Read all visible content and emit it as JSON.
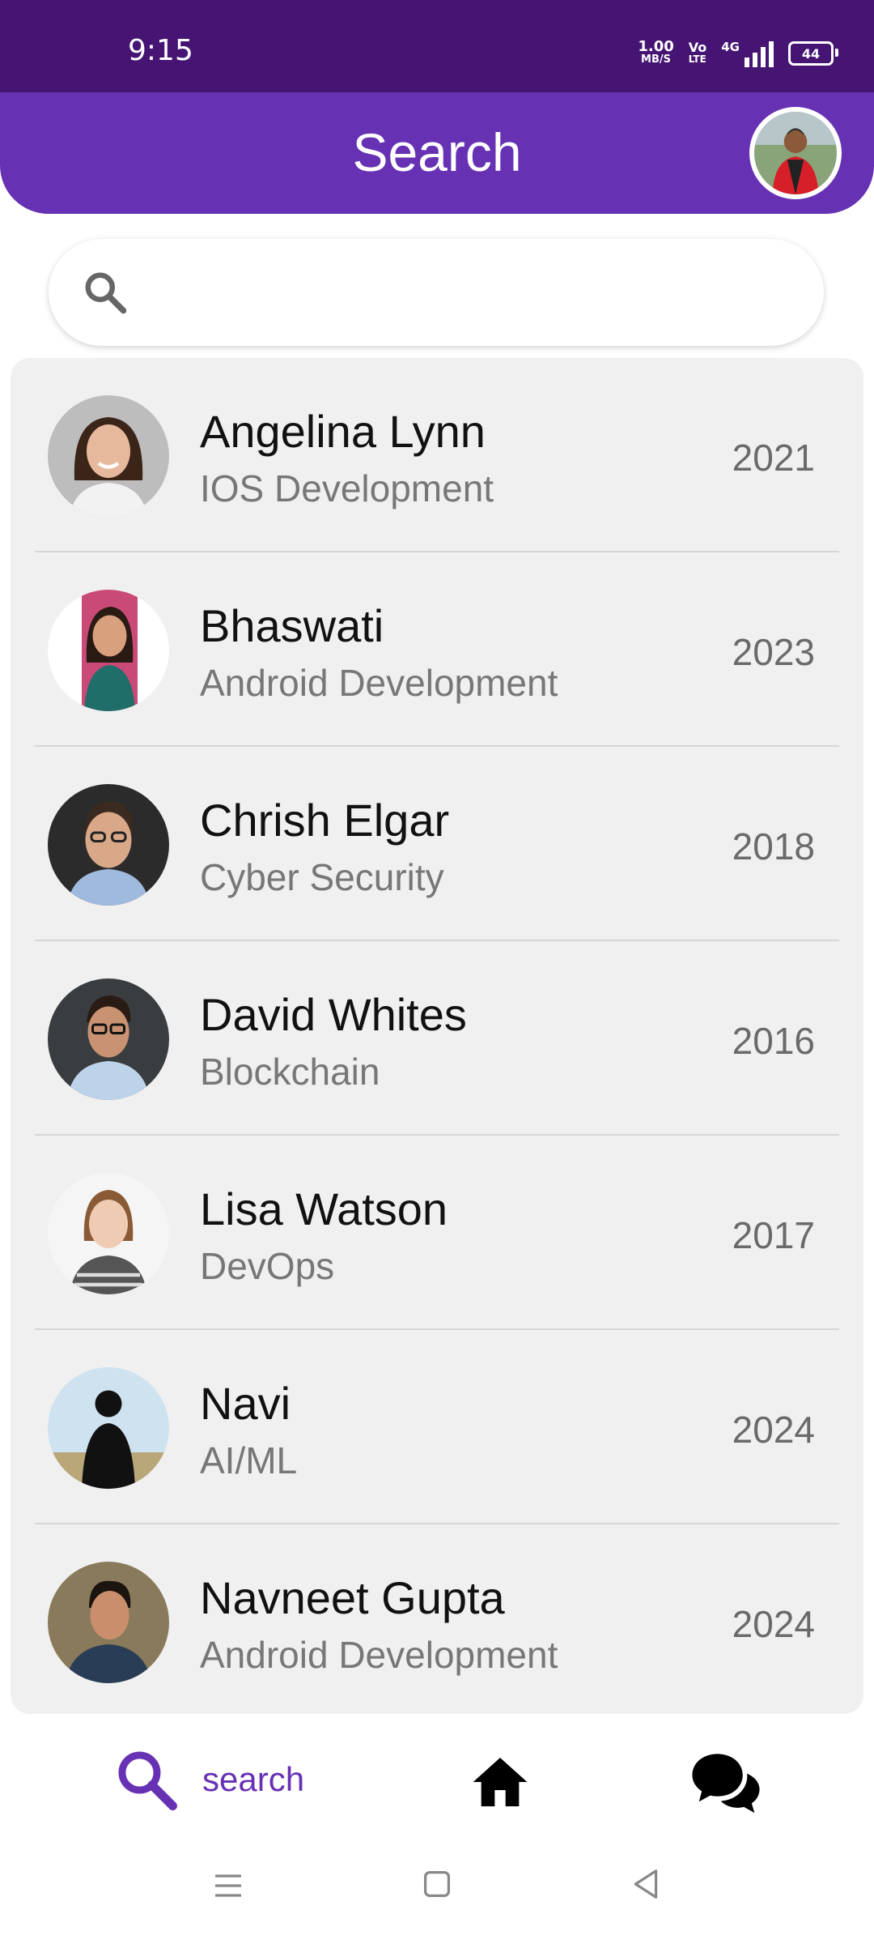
{
  "status_bar": {
    "time": "9:15",
    "speed_value": "1.00",
    "speed_unit": "MB/S",
    "volte_top": "Vo",
    "volte_bottom": "LTE",
    "network": "4G",
    "battery": "44"
  },
  "app_bar": {
    "title": "Search"
  },
  "search": {
    "placeholder": "",
    "value": ""
  },
  "results": [
    {
      "name": "Angelina Lynn",
      "course": "IOS Development",
      "year": "2021"
    },
    {
      "name": "Bhaswati",
      "course": "Android Development",
      "year": "2023"
    },
    {
      "name": "Chrish Elgar",
      "course": "Cyber Security",
      "year": "2018"
    },
    {
      "name": "David Whites",
      "course": "Blockchain",
      "year": "2016"
    },
    {
      "name": "Lisa Watson",
      "course": "DevOps",
      "year": "2017"
    },
    {
      "name": "Navi",
      "course": "AI/ML",
      "year": "2024"
    },
    {
      "name": "Navneet Gupta",
      "course": "Android Development",
      "year": "2024"
    }
  ],
  "bottom_nav": {
    "search_label": "search",
    "active": "search",
    "accent_color": "#6731b4",
    "icons": [
      "search-icon",
      "home-icon",
      "chat-icon"
    ]
  },
  "theme": {
    "status_bar_color": "#461573",
    "app_bar_color": "#6731b4"
  }
}
